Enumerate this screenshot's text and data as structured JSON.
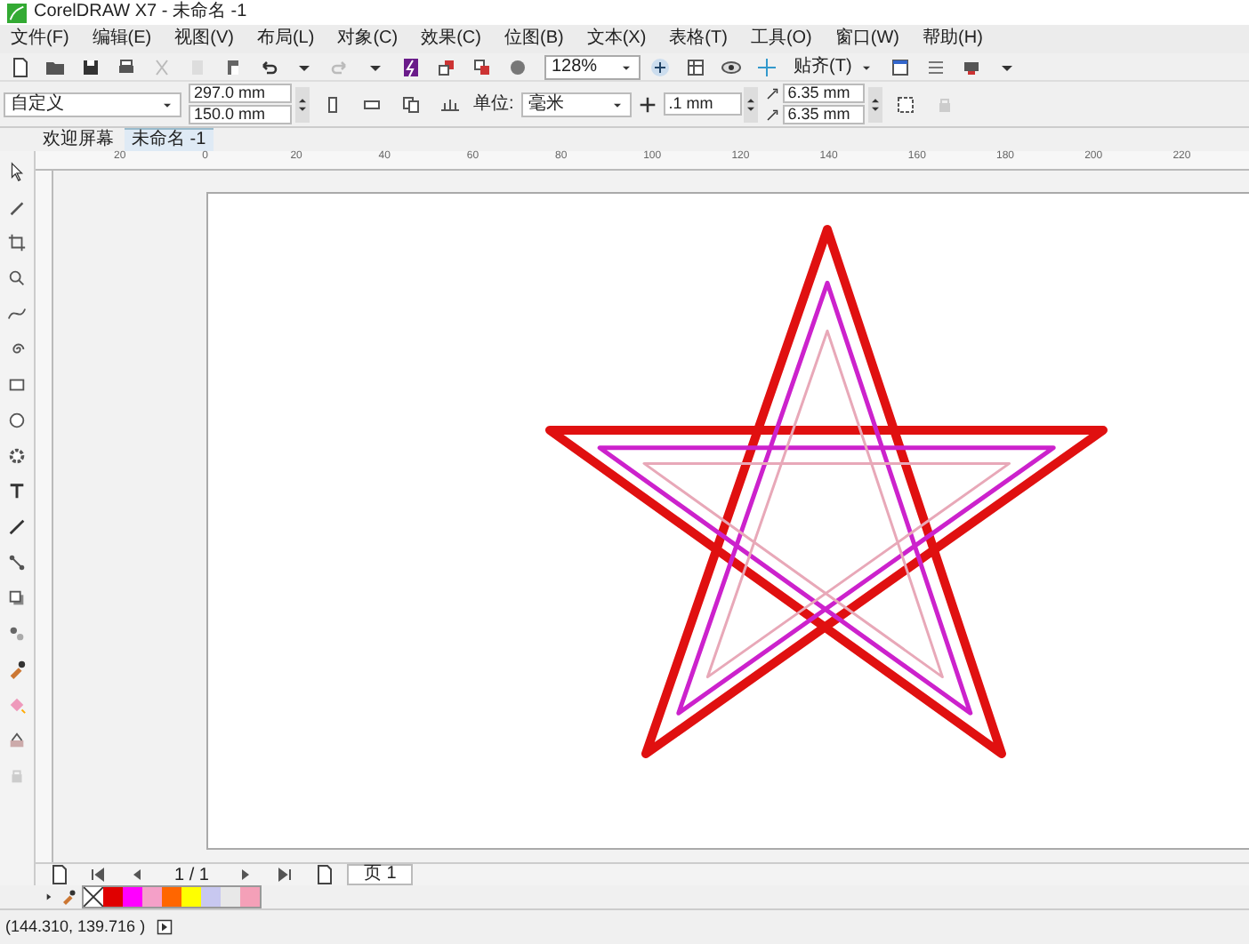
{
  "window": {
    "title": "CorelDRAW X7 - 未命名 -1"
  },
  "menu": [
    "文件(F)",
    "编辑(E)",
    "视图(V)",
    "布局(L)",
    "对象(C)",
    "效果(C)",
    "位图(B)",
    "文本(X)",
    "表格(T)",
    "工具(O)",
    "窗口(W)",
    "帮助(H)"
  ],
  "toolbar": {
    "zoom": "128%",
    "snap": "贴齐(T)"
  },
  "property_bar": {
    "preset": "自定义",
    "width": "297.0 mm",
    "height": "150.0 mm",
    "units_label": "单位:",
    "units": "毫米",
    "nudge": ".1 mm",
    "dup_x": "6.35 mm",
    "dup_y": "6.35 mm"
  },
  "doc_tabs": [
    {
      "label": "欢迎屏幕",
      "selected": false
    },
    {
      "label": "未命名 -1",
      "selected": true
    }
  ],
  "ruler": [
    "20",
    "0",
    "20",
    "40",
    "60",
    "80",
    "100",
    "120",
    "140",
    "160",
    "180",
    "200",
    "220"
  ],
  "page_nav": {
    "count": "1 / 1",
    "tab": "页 1"
  },
  "palette": [
    {
      "color": "#e00000"
    },
    {
      "color": "#ff00ff"
    },
    {
      "color": "#f4a0c8"
    },
    {
      "color": "#ff6600"
    },
    {
      "color": "#ffff00"
    },
    {
      "color": "#c8c8f0"
    },
    {
      "color": "#e8e8e8"
    },
    {
      "color": "#f4a0b8"
    }
  ],
  "status_bar": {
    "coordinates": "(144.310, 139.716 )"
  }
}
